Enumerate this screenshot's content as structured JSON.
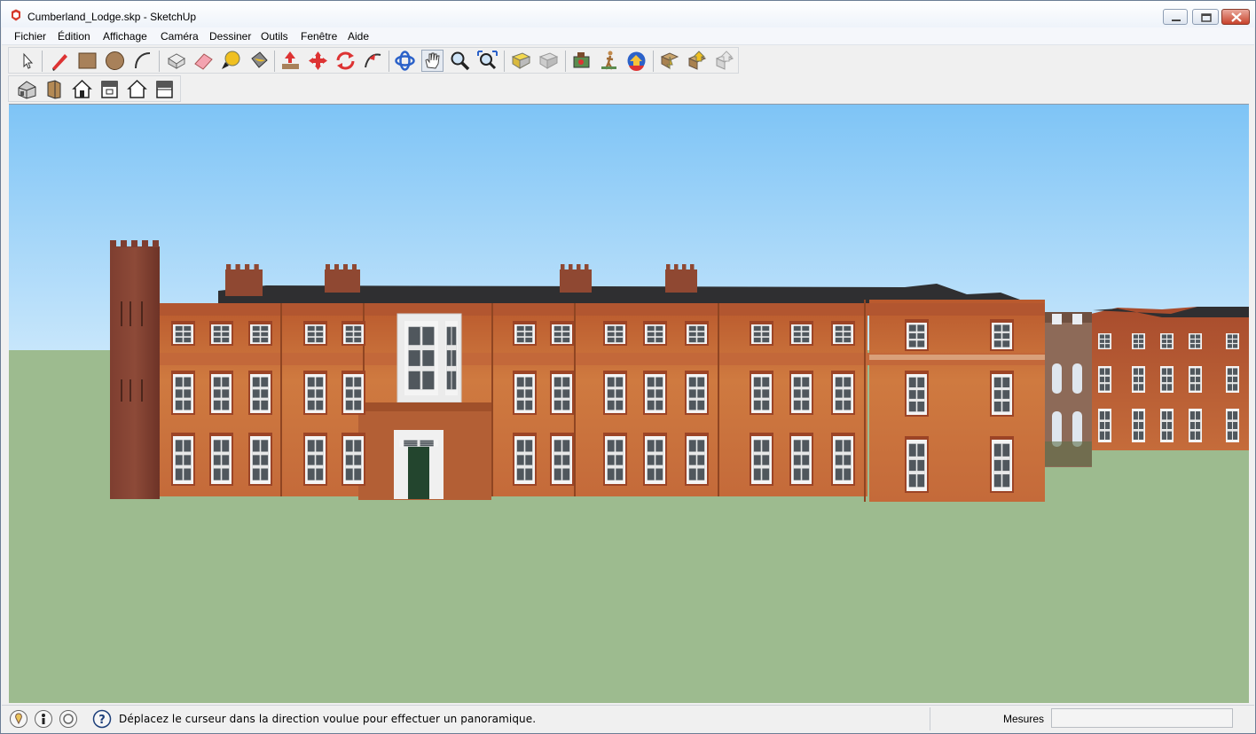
{
  "window": {
    "title": "Cumberland_Lodge.skp - SketchUp"
  },
  "menu": [
    {
      "id": "fichier",
      "label": "Fichier"
    },
    {
      "id": "edition",
      "label": "Édition"
    },
    {
      "id": "affichage",
      "label": "Affichage"
    },
    {
      "id": "camera",
      "label": "Caméra"
    },
    {
      "id": "dessiner",
      "label": "Dessiner"
    },
    {
      "id": "outils",
      "label": "Outils"
    },
    {
      "id": "fenetre",
      "label": "Fenêtre"
    },
    {
      "id": "aide",
      "label": "Aide"
    }
  ],
  "toolbar_main": [
    "select-arrow-icon",
    "pencil-line-icon",
    "rectangle-icon",
    "circle-icon",
    "arc-icon",
    "make-component-icon",
    "eraser-icon",
    "tape-measure-icon",
    "paint-bucket-icon",
    "push-pull-icon",
    "move-icon",
    "rotate-icon",
    "follow-me-icon",
    "orbit-icon",
    "pan-hand-icon",
    "zoom-icon",
    "zoom-extents-icon",
    "previous-view-icon",
    "next-view-icon",
    "position-camera-icon",
    "walk-icon",
    "look-around-icon",
    "get-models-icon",
    "share-model-icon",
    "share-component-icon"
  ],
  "toolbar_views": [
    "iso-view-icon",
    "top-view-icon",
    "front-view-icon",
    "right-view-icon",
    "back-view-icon",
    "left-view-icon"
  ],
  "status": {
    "message": "Déplacez le curseur dans la direction voulue pour effectuer un panoramique.",
    "measures_label": "Mesures",
    "measures_value": ""
  },
  "colors": {
    "sky_top": "#7dc6f7",
    "sky_bottom": "#c5e6fb",
    "ground": "#9dbb8f",
    "brick": "#c56c3b",
    "roof": "#2f2f31"
  }
}
